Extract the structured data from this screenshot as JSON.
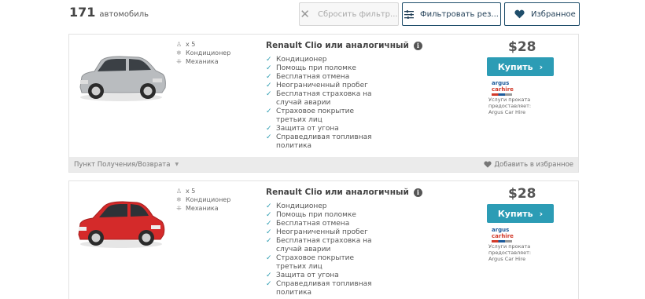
{
  "header": {
    "count": "171",
    "count_label": "автомобиль",
    "reset_label": "Сбросить фильтр...",
    "filter_label": "Фильтровать рез...",
    "favorites_label": "Избранное"
  },
  "colors": {
    "accent": "#2c9cb5",
    "navy": "#1f4e6b",
    "check": "#2a9bb0"
  },
  "cards": [
    {
      "car_color": "#b9bcbf",
      "specs": {
        "passengers": "x 5",
        "ac": "Кондиционер",
        "transmission": "Механика"
      },
      "title": "Renault Clio или аналогичный",
      "features": [
        "Кондиционер",
        "Помощь при поломке",
        "Бесплатная отмена",
        "Неограниченный пробег",
        "Бесплатная страховка на случай аварии",
        "Страховое покрытие третьих лиц",
        "Защита от угона",
        "Справедливая топливная политика"
      ],
      "price": "$28",
      "buy_label": "Купить",
      "supplier_logo": {
        "line1": "argus",
        "line2": "carhire"
      },
      "supplier_text": "Услуги проката предоставляет: Argus Car Hire",
      "pickup_label": "Пункт Получения/Возврата",
      "add_fav_label": "Добавить в избранное"
    },
    {
      "car_color": "#d42a2a",
      "specs": {
        "passengers": "x 5",
        "ac": "Кондиционер",
        "transmission": "Механика"
      },
      "title": "Renault Clio или аналогичный",
      "features": [
        "Кондиционер",
        "Помощь при поломке",
        "Бесплатная отмена",
        "Неограниченный пробег",
        "Бесплатная страховка на случай аварии",
        "Страховое покрытие третьих лиц",
        "Защита от угона",
        "Справедливая топливная политика"
      ],
      "price": "$28",
      "buy_label": "Купить",
      "supplier_logo": {
        "line1": "argus",
        "line2": "carhire"
      },
      "supplier_text": "Услуги проката предоставляет: Argus Car Hire"
    }
  ]
}
